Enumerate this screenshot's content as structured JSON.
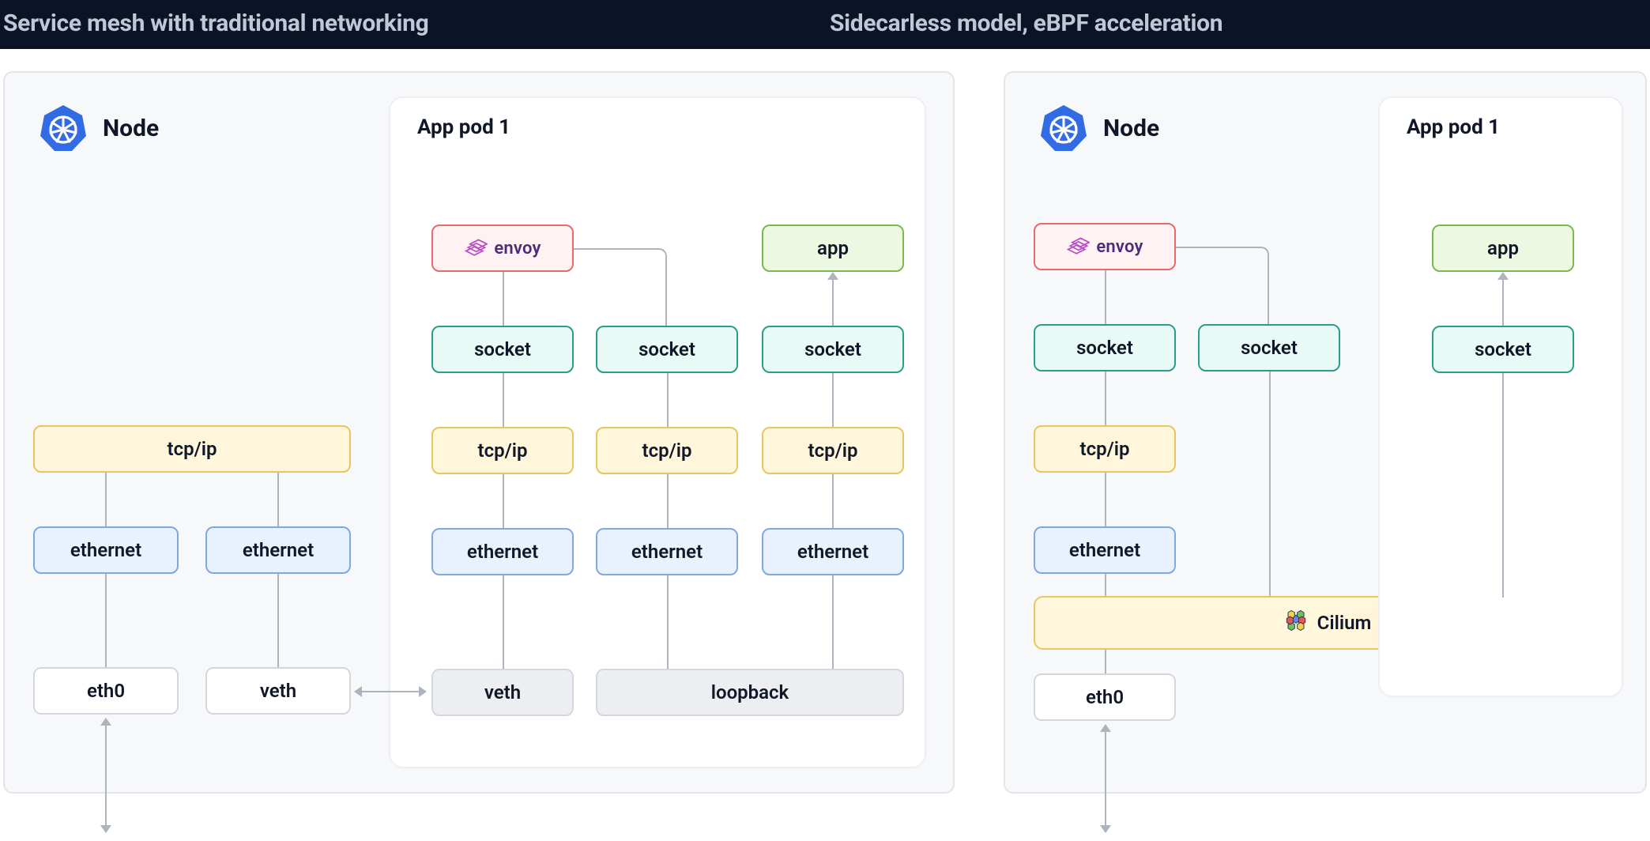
{
  "header": {
    "left_title": "Service mesh with traditional networking",
    "right_title": "Sidecarless model, eBPF acceleration"
  },
  "left": {
    "node_label": "Node",
    "pod_title": "App pod 1",
    "envoy_label": "envoy",
    "app_label": "app",
    "socket_label": "socket",
    "tcpip_label": "tcp/ip",
    "ethernet_label": "ethernet",
    "eth0_label": "eth0",
    "veth_label": "veth",
    "loopback_label": "loopback"
  },
  "right": {
    "node_label": "Node",
    "pod_title": "App pod 1",
    "envoy_label": "envoy",
    "app_label": "app",
    "socket_label": "socket",
    "tcpip_label": "tcp/ip",
    "ethernet_label": "ethernet",
    "eth0_label": "eth0",
    "cilium_label": "Cilium"
  },
  "colors": {
    "header_fg": "#bfc8d6",
    "header_bg": "#0b1426",
    "panel_bg": "#f7f8fa",
    "pod_bg": "#ffffff",
    "connector": "#aeb4bd"
  }
}
